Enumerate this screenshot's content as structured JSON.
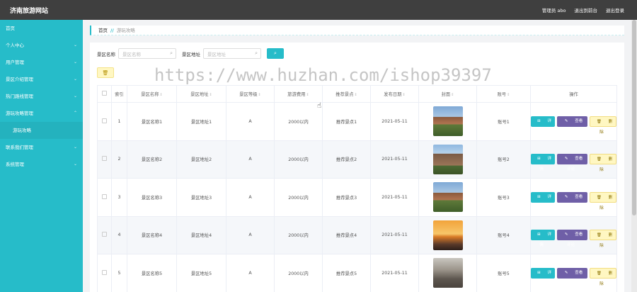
{
  "app": {
    "title": "济南旅游网站"
  },
  "top_links": [
    "管理员 abo",
    "退出到前台",
    "退出登录"
  ],
  "sidebar": {
    "items": [
      {
        "label": "首页",
        "expandable": false
      },
      {
        "label": "个人中心",
        "expandable": true
      },
      {
        "label": "用户管理",
        "expandable": true
      },
      {
        "label": "景区介绍管理",
        "expandable": true
      },
      {
        "label": "热门路线管理",
        "expandable": true
      },
      {
        "label": "游玩攻略管理",
        "expandable": true,
        "expanded": true
      },
      {
        "label": "游玩攻略",
        "sub": true
      },
      {
        "label": "联系我们管理",
        "expandable": true
      },
      {
        "label": "系统管理",
        "expandable": true
      }
    ]
  },
  "breadcrumb": {
    "home": "首页",
    "sep": "//",
    "current": "游玩攻略"
  },
  "search": {
    "name_label": "景区名称",
    "name_placeholder": "景区名称",
    "addr_label": "景区地址",
    "addr_placeholder": "景区地址",
    "button_icon": "search-icon"
  },
  "delete_icon": "trash-icon",
  "table": {
    "headers": [
      "",
      "索引",
      "景区名称",
      "景区地址",
      "景区等级",
      "旅游费用",
      "推荐景点",
      "发布日期",
      "封面",
      "账号",
      "操作"
    ],
    "rows": [
      {
        "index": "1",
        "name": "景区名称1",
        "addr": "景区地址1",
        "level": "A",
        "cost": "2000以内",
        "spot": "推荐景点1",
        "date": "2021-05-11",
        "account": "账号1",
        "cover": "pagoda"
      },
      {
        "index": "2",
        "name": "景区名称2",
        "addr": "景区地址2",
        "level": "A",
        "cost": "2000以内",
        "spot": "推荐景点2",
        "date": "2021-05-11",
        "account": "账号2",
        "cover": "tower"
      },
      {
        "index": "3",
        "name": "景区名称3",
        "addr": "景区地址3",
        "level": "A",
        "cost": "2000以内",
        "spot": "推荐景点3",
        "date": "2021-05-11",
        "account": "账号3",
        "cover": "pagoda"
      },
      {
        "index": "4",
        "name": "景区名称4",
        "addr": "景区地址4",
        "level": "A",
        "cost": "2000以内",
        "spot": "推荐景点4",
        "date": "2021-05-11",
        "account": "账号4",
        "cover": "sunset"
      },
      {
        "index": "5",
        "name": "景区名称5",
        "addr": "景区地址5",
        "level": "A",
        "cost": "2000以内",
        "spot": "推荐景点5",
        "date": "2021-05-11",
        "account": "账号5",
        "cover": "temple"
      }
    ],
    "ops": {
      "edit": "详情",
      "review": "查看评论",
      "delete": "删除"
    }
  },
  "watermark": "https://www.huzhan.com/ishop39397",
  "colors": {
    "accent": "#26bcc9",
    "topbar": "#3f3f3f",
    "review": "#6f5fa7",
    "delete_bg": "#fff7c2"
  }
}
